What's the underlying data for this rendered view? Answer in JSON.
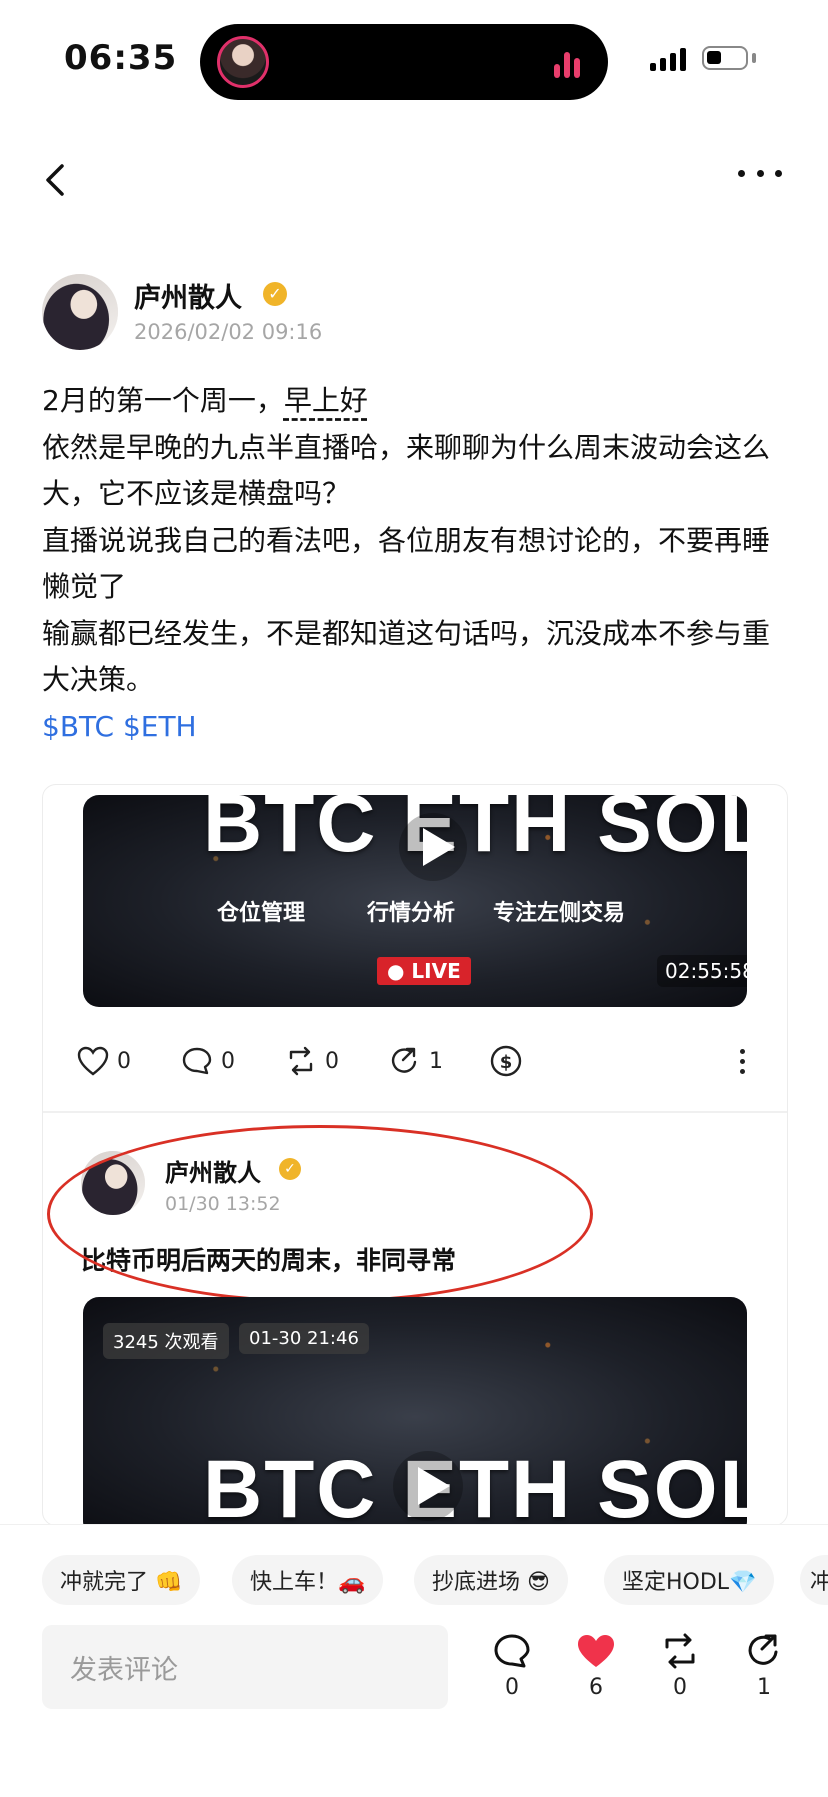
{
  "status_bar": {
    "time": "06:35"
  },
  "post": {
    "author": "庐州散人",
    "date": "2026/02/02 09:16",
    "lines": [
      {
        "prefix": "2月的第一个周一，",
        "emphasis": "早上好"
      },
      "依然是早晚的九点半直播哈，来聊聊为什么周末波动会这么大，它不应该是横盘吗？",
      "直播说说我自己的看法吧，各位朋友有想讨论的，不要再睡懒觉了",
      "输赢都已经发生，不是都知道这句话吗，沉没成本不参与重大决策。"
    ],
    "tags": "$BTC $ETH"
  },
  "video1": {
    "title": "BTC ETH SOL",
    "subtitles": [
      "仓位管理",
      "行情分析",
      "专注左侧交易"
    ],
    "live_label": "● LIVE",
    "duration": "02:55:58"
  },
  "card_actions": {
    "likes": "0",
    "comments": "0",
    "reposts": "0",
    "shares": "1"
  },
  "repost": {
    "author": "庐州散人",
    "date": "01/30 13:52",
    "text": "比特币明后两天的周末，非同寻常"
  },
  "video2": {
    "title": "BTC ETH SOL",
    "views": "3245 次观看",
    "date": "01-30 21:46"
  },
  "quick_replies": [
    "冲就完了 👊",
    "快上车！🚗",
    "抄底进场 😎",
    "坚定HODL💎",
    "冲"
  ],
  "comment_placeholder": "发表评论",
  "bottom_actions": {
    "comments": "0",
    "likes": "6",
    "reposts": "0",
    "shares": "1"
  },
  "colors": {
    "accent_blue": "#2f6fe0",
    "verified_gold": "#f0b429",
    "live_red": "#d8232a",
    "like_red": "#f0334b",
    "annotation_red": "#d93025"
  }
}
